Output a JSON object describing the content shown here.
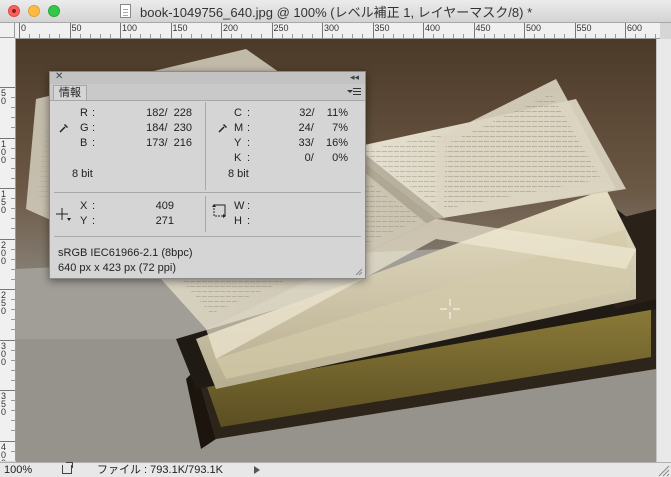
{
  "window": {
    "title": "book-1049756_640.jpg @ 100% (レベル補正 1, レイヤーマスク/8) *",
    "controls": [
      "close",
      "minimize",
      "maximize"
    ]
  },
  "ruler_top_labels": [
    "0",
    "50",
    "100",
    "150",
    "200",
    "250",
    "300",
    "350",
    "400",
    "450",
    "500",
    "550",
    "600"
  ],
  "ruler_left_labels": [
    "5 0",
    "1 0 0",
    "1 5 0",
    "2 0 0",
    "2 5 0",
    "3 0 0",
    "3 5 0",
    "4 0 0"
  ],
  "info_panel": {
    "tab": "情報",
    "rgb": {
      "labels": [
        "R",
        "G",
        "B"
      ],
      "values": [
        "182/  228",
        "184/  230",
        "173/  216"
      ],
      "bitdepth": "8 bit"
    },
    "cmyk": {
      "labels": [
        "C",
        "M",
        "Y",
        "K"
      ],
      "values": [
        "32/    11%",
        "24/      7%",
        "33/    16%",
        "0/      0%"
      ],
      "bitdepth": "8 bit"
    },
    "position": {
      "labels": [
        "X",
        "Y"
      ],
      "values": [
        "409",
        "271"
      ]
    },
    "size": {
      "labels": [
        "W",
        "H"
      ],
      "values": [
        "",
        ""
      ]
    },
    "doc_profile": "sRGB IEC61966-2.1 (8bpc)",
    "doc_dimensions": "640 px x 423 px (72 ppi)"
  },
  "statusbar": {
    "zoom": "100%",
    "file_info": "ファイル : 793.1K/793.1K"
  },
  "icons": [
    "doc-icon",
    "close-icon",
    "collapse-icon",
    "panel-menu-icon",
    "eyedropper-icon",
    "crosshair-icon",
    "size-icon",
    "share-icon",
    "arrow-right-icon",
    "resize-grip-icon"
  ]
}
